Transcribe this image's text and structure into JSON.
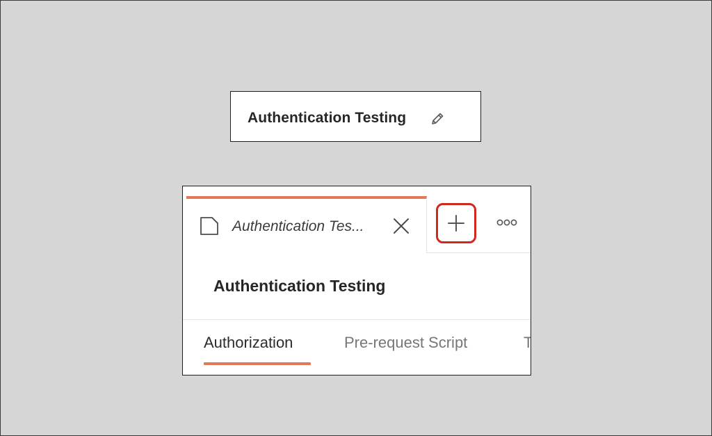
{
  "header_card": {
    "title": "Authentication Testing",
    "edit_icon": "pencil-icon"
  },
  "tab_strip": {
    "active_tab": {
      "label": "Authentication Tes...",
      "icon": "document-icon",
      "close_icon": "close-icon"
    },
    "new_tab_icon": "plus-icon",
    "more_icon": "more-options-icon"
  },
  "collection": {
    "title": "Authentication Testing",
    "tabs": [
      {
        "label": "Authorization",
        "selected": true
      },
      {
        "label": "Pre-request Script",
        "selected": false
      },
      {
        "label": "T",
        "selected": false
      }
    ]
  },
  "colors": {
    "accent": "#e07a58",
    "highlight": "#d1281d",
    "background": "#d6d6d6",
    "text": "#262626",
    "muted_text": "#777777"
  }
}
